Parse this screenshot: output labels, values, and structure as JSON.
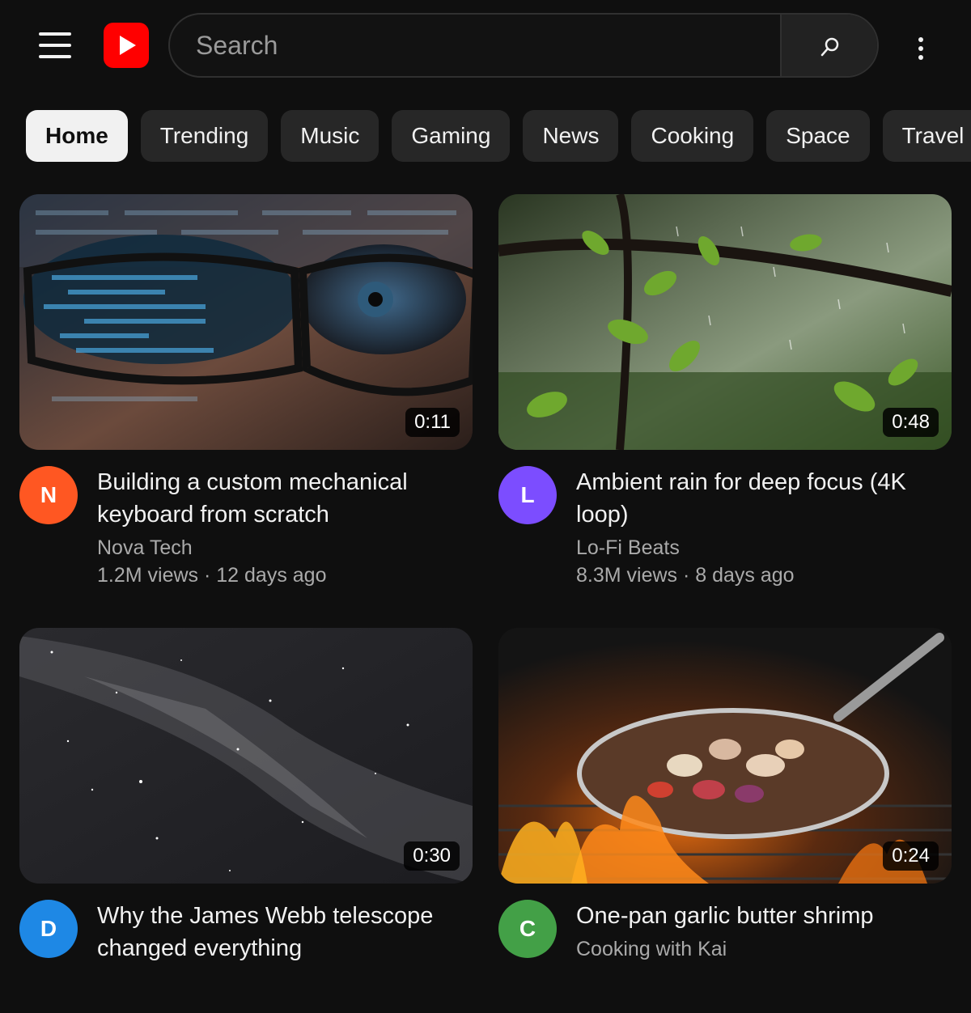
{
  "header": {
    "search_placeholder": "Search",
    "logo_icon": "youtube-play-logo",
    "accent": "#ff0000"
  },
  "chips": [
    {
      "label": "Home",
      "active": true
    },
    {
      "label": "Trending"
    },
    {
      "label": "Music"
    },
    {
      "label": "Gaming"
    },
    {
      "label": "News"
    },
    {
      "label": "Cooking"
    },
    {
      "label": "Space"
    },
    {
      "label": "Travel"
    }
  ],
  "videos": [
    {
      "title": "Building a custom mechanical keyboard from scratch",
      "channel": "Nova Tech",
      "avatar_letter": "N",
      "avatar_color": "#ff5722",
      "views": "1.2M views",
      "age": "12 days ago",
      "duration": "0:11"
    },
    {
      "title": "Ambient rain for deep focus (4K loop)",
      "channel": "Lo-Fi Beats",
      "avatar_letter": "L",
      "avatar_color": "#7c4dff",
      "views": "8.3M views",
      "age": "8 days ago",
      "duration": "0:48"
    },
    {
      "title": "Why the James Webb telescope changed everything",
      "channel": "",
      "avatar_letter": "D",
      "avatar_color": "#1e88e5",
      "views": "",
      "age": "",
      "duration": "0:30"
    },
    {
      "title": "One-pan garlic butter shrimp",
      "channel": "Cooking with Kai",
      "avatar_letter": "C",
      "avatar_color": "#43a047",
      "views": "",
      "age": "",
      "duration": "0:24"
    }
  ]
}
